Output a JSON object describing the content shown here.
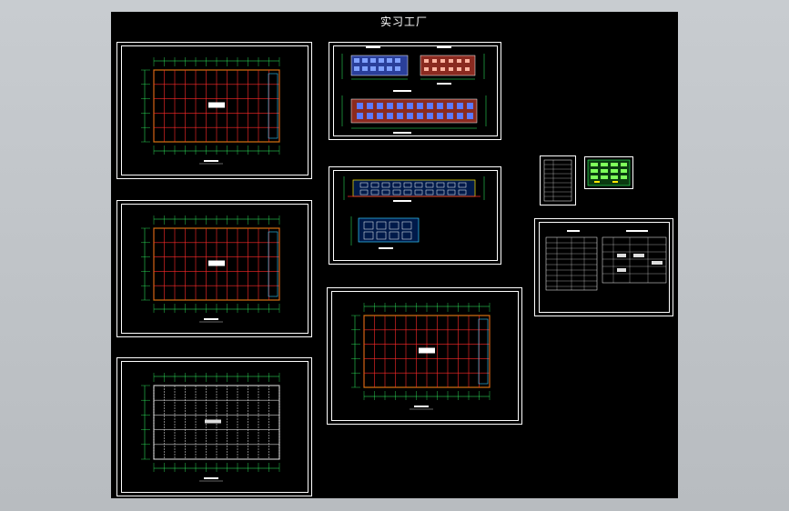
{
  "title": "实习工厂",
  "colors": {
    "background": "#000000",
    "sheet_border": "#ffffff",
    "grid_red": "#ff2a2a",
    "dim_green": "#33ff66",
    "wall_yellow": "#ffe800",
    "accent_cyan": "#33ccff",
    "facade_brick": "#8a2a20",
    "facade_glass": "#3b5bd9"
  },
  "sheets": [
    {
      "id": "plan-1",
      "kind": "floor-plan"
    },
    {
      "id": "plan-2",
      "kind": "floor-plan"
    },
    {
      "id": "plan-3",
      "kind": "floor-plan"
    },
    {
      "id": "plan-4",
      "kind": "floor-plan"
    },
    {
      "id": "elevations-1",
      "kind": "elevation"
    },
    {
      "id": "elevations-2",
      "kind": "elevation"
    },
    {
      "id": "index-table",
      "kind": "table"
    },
    {
      "id": "notes-table",
      "kind": "table"
    },
    {
      "id": "thumbnail-green",
      "kind": "detail"
    }
  ]
}
